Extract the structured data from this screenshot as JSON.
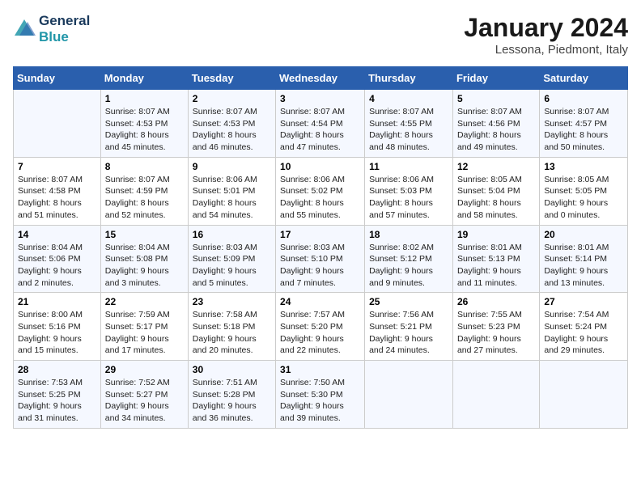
{
  "header": {
    "logo_line1": "General",
    "logo_line2": "Blue",
    "month_title": "January 2024",
    "location": "Lessona, Piedmont, Italy"
  },
  "weekdays": [
    "Sunday",
    "Monday",
    "Tuesday",
    "Wednesday",
    "Thursday",
    "Friday",
    "Saturday"
  ],
  "weeks": [
    [
      {
        "day": "",
        "sunrise": "",
        "sunset": "",
        "daylight": ""
      },
      {
        "day": "1",
        "sunrise": "Sunrise: 8:07 AM",
        "sunset": "Sunset: 4:53 PM",
        "daylight": "Daylight: 8 hours and 45 minutes."
      },
      {
        "day": "2",
        "sunrise": "Sunrise: 8:07 AM",
        "sunset": "Sunset: 4:53 PM",
        "daylight": "Daylight: 8 hours and 46 minutes."
      },
      {
        "day": "3",
        "sunrise": "Sunrise: 8:07 AM",
        "sunset": "Sunset: 4:54 PM",
        "daylight": "Daylight: 8 hours and 47 minutes."
      },
      {
        "day": "4",
        "sunrise": "Sunrise: 8:07 AM",
        "sunset": "Sunset: 4:55 PM",
        "daylight": "Daylight: 8 hours and 48 minutes."
      },
      {
        "day": "5",
        "sunrise": "Sunrise: 8:07 AM",
        "sunset": "Sunset: 4:56 PM",
        "daylight": "Daylight: 8 hours and 49 minutes."
      },
      {
        "day": "6",
        "sunrise": "Sunrise: 8:07 AM",
        "sunset": "Sunset: 4:57 PM",
        "daylight": "Daylight: 8 hours and 50 minutes."
      }
    ],
    [
      {
        "day": "7",
        "sunrise": "Sunrise: 8:07 AM",
        "sunset": "Sunset: 4:58 PM",
        "daylight": "Daylight: 8 hours and 51 minutes."
      },
      {
        "day": "8",
        "sunrise": "Sunrise: 8:07 AM",
        "sunset": "Sunset: 4:59 PM",
        "daylight": "Daylight: 8 hours and 52 minutes."
      },
      {
        "day": "9",
        "sunrise": "Sunrise: 8:06 AM",
        "sunset": "Sunset: 5:01 PM",
        "daylight": "Daylight: 8 hours and 54 minutes."
      },
      {
        "day": "10",
        "sunrise": "Sunrise: 8:06 AM",
        "sunset": "Sunset: 5:02 PM",
        "daylight": "Daylight: 8 hours and 55 minutes."
      },
      {
        "day": "11",
        "sunrise": "Sunrise: 8:06 AM",
        "sunset": "Sunset: 5:03 PM",
        "daylight": "Daylight: 8 hours and 57 minutes."
      },
      {
        "day": "12",
        "sunrise": "Sunrise: 8:05 AM",
        "sunset": "Sunset: 5:04 PM",
        "daylight": "Daylight: 8 hours and 58 minutes."
      },
      {
        "day": "13",
        "sunrise": "Sunrise: 8:05 AM",
        "sunset": "Sunset: 5:05 PM",
        "daylight": "Daylight: 9 hours and 0 minutes."
      }
    ],
    [
      {
        "day": "14",
        "sunrise": "Sunrise: 8:04 AM",
        "sunset": "Sunset: 5:06 PM",
        "daylight": "Daylight: 9 hours and 2 minutes."
      },
      {
        "day": "15",
        "sunrise": "Sunrise: 8:04 AM",
        "sunset": "Sunset: 5:08 PM",
        "daylight": "Daylight: 9 hours and 3 minutes."
      },
      {
        "day": "16",
        "sunrise": "Sunrise: 8:03 AM",
        "sunset": "Sunset: 5:09 PM",
        "daylight": "Daylight: 9 hours and 5 minutes."
      },
      {
        "day": "17",
        "sunrise": "Sunrise: 8:03 AM",
        "sunset": "Sunset: 5:10 PM",
        "daylight": "Daylight: 9 hours and 7 minutes."
      },
      {
        "day": "18",
        "sunrise": "Sunrise: 8:02 AM",
        "sunset": "Sunset: 5:12 PM",
        "daylight": "Daylight: 9 hours and 9 minutes."
      },
      {
        "day": "19",
        "sunrise": "Sunrise: 8:01 AM",
        "sunset": "Sunset: 5:13 PM",
        "daylight": "Daylight: 9 hours and 11 minutes."
      },
      {
        "day": "20",
        "sunrise": "Sunrise: 8:01 AM",
        "sunset": "Sunset: 5:14 PM",
        "daylight": "Daylight: 9 hours and 13 minutes."
      }
    ],
    [
      {
        "day": "21",
        "sunrise": "Sunrise: 8:00 AM",
        "sunset": "Sunset: 5:16 PM",
        "daylight": "Daylight: 9 hours and 15 minutes."
      },
      {
        "day": "22",
        "sunrise": "Sunrise: 7:59 AM",
        "sunset": "Sunset: 5:17 PM",
        "daylight": "Daylight: 9 hours and 17 minutes."
      },
      {
        "day": "23",
        "sunrise": "Sunrise: 7:58 AM",
        "sunset": "Sunset: 5:18 PM",
        "daylight": "Daylight: 9 hours and 20 minutes."
      },
      {
        "day": "24",
        "sunrise": "Sunrise: 7:57 AM",
        "sunset": "Sunset: 5:20 PM",
        "daylight": "Daylight: 9 hours and 22 minutes."
      },
      {
        "day": "25",
        "sunrise": "Sunrise: 7:56 AM",
        "sunset": "Sunset: 5:21 PM",
        "daylight": "Daylight: 9 hours and 24 minutes."
      },
      {
        "day": "26",
        "sunrise": "Sunrise: 7:55 AM",
        "sunset": "Sunset: 5:23 PM",
        "daylight": "Daylight: 9 hours and 27 minutes."
      },
      {
        "day": "27",
        "sunrise": "Sunrise: 7:54 AM",
        "sunset": "Sunset: 5:24 PM",
        "daylight": "Daylight: 9 hours and 29 minutes."
      }
    ],
    [
      {
        "day": "28",
        "sunrise": "Sunrise: 7:53 AM",
        "sunset": "Sunset: 5:25 PM",
        "daylight": "Daylight: 9 hours and 31 minutes."
      },
      {
        "day": "29",
        "sunrise": "Sunrise: 7:52 AM",
        "sunset": "Sunset: 5:27 PM",
        "daylight": "Daylight: 9 hours and 34 minutes."
      },
      {
        "day": "30",
        "sunrise": "Sunrise: 7:51 AM",
        "sunset": "Sunset: 5:28 PM",
        "daylight": "Daylight: 9 hours and 36 minutes."
      },
      {
        "day": "31",
        "sunrise": "Sunrise: 7:50 AM",
        "sunset": "Sunset: 5:30 PM",
        "daylight": "Daylight: 9 hours and 39 minutes."
      },
      {
        "day": "",
        "sunrise": "",
        "sunset": "",
        "daylight": ""
      },
      {
        "day": "",
        "sunrise": "",
        "sunset": "",
        "daylight": ""
      },
      {
        "day": "",
        "sunrise": "",
        "sunset": "",
        "daylight": ""
      }
    ]
  ]
}
